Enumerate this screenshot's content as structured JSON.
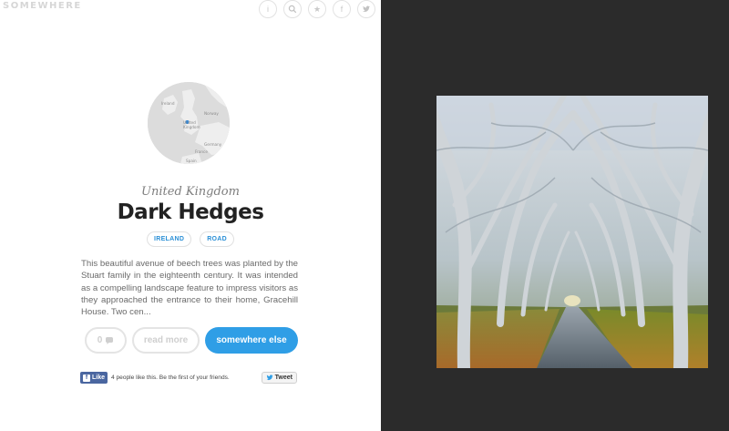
{
  "header": {
    "logo": "SOMEWHERE",
    "icons": [
      {
        "name": "info-icon",
        "glyph": "i"
      },
      {
        "name": "search-icon",
        "glyph": ""
      },
      {
        "name": "star-icon",
        "glyph": "★"
      },
      {
        "name": "facebook-icon",
        "glyph": "f"
      },
      {
        "name": "twitter-icon",
        "glyph": ""
      }
    ]
  },
  "map": {
    "labels": [
      "Ireland",
      "United Kingdom",
      "Norway",
      "Germany",
      "France",
      "Spain"
    ]
  },
  "place": {
    "country": "United Kingdom",
    "title": "Dark Hedges",
    "tags": [
      "IRELAND",
      "ROAD"
    ],
    "description": "This beautiful avenue of beech trees was planted by the Stuart family in the eighteenth century. It was intended as a compelling landscape feature to impress visitors as they approached the entrance to their home, Gracehill House. Two cen..."
  },
  "actions": {
    "comment_count": "0",
    "read_more": "read more",
    "somewhere_else": "somewhere else"
  },
  "social": {
    "fb_like": "Like",
    "fb_text": "4 people like this. Be the first of your friends.",
    "tweet": "Tweet"
  },
  "colors": {
    "accent": "#2f9ee6",
    "tag_text": "#2a8fd6",
    "right_panel": "#2b2b2b",
    "facebook": "#4a66a0"
  }
}
